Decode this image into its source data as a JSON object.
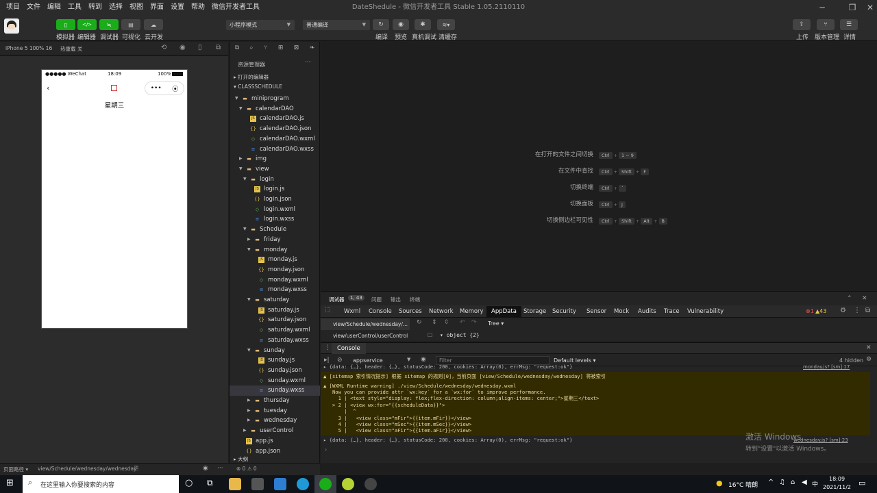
{
  "window": {
    "title": "DateShedule - 微信开发者工具 Stable 1.05.2110110",
    "menu": [
      "项目",
      "文件",
      "编辑",
      "工具",
      "转到",
      "选择",
      "视图",
      "界面",
      "设置",
      "帮助",
      "微信开发者工具"
    ]
  },
  "toolbar": {
    "simulator_label": "模拟器",
    "editor_label": "编辑器",
    "debugger_label": "调试器",
    "visual_label": "可视化",
    "cloud_label": "云开发",
    "mode_select": "小程序模式",
    "compile_select": "普通编译",
    "compile_label": "编译",
    "preview_label": "预览",
    "device_debug_label": "真机调试",
    "clear_cache_label": "清缓存",
    "upload_label": "上传",
    "version_label": "版本管理",
    "details_label": "详情"
  },
  "simulator": {
    "device": "iPhone 5 100% 16",
    "hot_reload": "热重载 关",
    "status_carrier": "●●●●● WeChat",
    "status_time": "18:09",
    "status_battery": "100%",
    "page_text": "星期三"
  },
  "explorer": {
    "title": "资源管理器",
    "open_editors": "打开的编辑器",
    "project": "CLASSSCHEDULE",
    "items": [
      {
        "label": "miniprogram",
        "type": "folder"
      },
      {
        "label": "calendarDAO",
        "type": "folder"
      },
      {
        "label": "calendarDAO.js",
        "type": "js"
      },
      {
        "label": "calendarDAO.json",
        "type": "json"
      },
      {
        "label": "calendarDAO.wxml",
        "type": "wxml"
      },
      {
        "label": "calendarDAO.wxss",
        "type": "wxss"
      },
      {
        "label": "img",
        "type": "folder"
      },
      {
        "label": "view",
        "type": "folder"
      },
      {
        "label": "login",
        "type": "folder"
      },
      {
        "label": "login.js",
        "type": "js"
      },
      {
        "label": "login.json",
        "type": "json"
      },
      {
        "label": "login.wxml",
        "type": "wxml"
      },
      {
        "label": "login.wxss",
        "type": "wxss"
      },
      {
        "label": "Schedule",
        "type": "folder"
      },
      {
        "label": "friday",
        "type": "folder"
      },
      {
        "label": "monday",
        "type": "folder"
      },
      {
        "label": "monday.js",
        "type": "js"
      },
      {
        "label": "monday.json",
        "type": "json"
      },
      {
        "label": "monday.wxml",
        "type": "wxml"
      },
      {
        "label": "monday.wxss",
        "type": "wxss"
      },
      {
        "label": "saturday",
        "type": "folder"
      },
      {
        "label": "saturday.js",
        "type": "js"
      },
      {
        "label": "saturday.json",
        "type": "json"
      },
      {
        "label": "saturday.wxml",
        "type": "wxml"
      },
      {
        "label": "saturday.wxss",
        "type": "wxss"
      },
      {
        "label": "sunday",
        "type": "folder"
      },
      {
        "label": "sunday.js",
        "type": "js"
      },
      {
        "label": "sunday.json",
        "type": "json"
      },
      {
        "label": "sunday.wxml",
        "type": "wxml"
      },
      {
        "label": "sunday.wxss",
        "type": "wxss"
      },
      {
        "label": "thursday",
        "type": "folder"
      },
      {
        "label": "tuesday",
        "type": "folder"
      },
      {
        "label": "wednesday",
        "type": "folder"
      },
      {
        "label": "userControl",
        "type": "folder"
      },
      {
        "label": "app.js",
        "type": "js"
      },
      {
        "label": "app.json",
        "type": "json"
      }
    ],
    "outline": "大纲"
  },
  "editor_hints": [
    {
      "label": "在打开的文件之间切换",
      "keys": [
        "Ctrl",
        "1 ~ 9"
      ]
    },
    {
      "label": "在文件中查找",
      "keys": [
        "Ctrl",
        "Shift",
        "F"
      ]
    },
    {
      "label": "切换终端",
      "keys": [
        "Ctrl",
        "`"
      ]
    },
    {
      "label": "切换面板",
      "keys": [
        "Ctrl",
        "J"
      ]
    },
    {
      "label": "切换侧边栏可见性",
      "keys": [
        "Ctrl",
        "Shift",
        "Alt",
        "B"
      ]
    }
  ],
  "devtools": {
    "panel_tabs": [
      "调试器",
      "问题",
      "输出",
      "终端"
    ],
    "debugger_badge": "1, 43",
    "tabs": [
      "Wxml",
      "Console",
      "Sources",
      "Network",
      "Memory",
      "AppData",
      "Storage",
      "Security",
      "Sensor",
      "Mock",
      "Audits",
      "Trace",
      "Vulnerability"
    ],
    "error_count": "1",
    "warn_count": "43",
    "appdata_pages": [
      "view/Schedule/wednesday/...",
      "view/userControl/userControl"
    ],
    "tree_mode": "Tree",
    "object_summary": "object {2}",
    "console_title": "Console",
    "context": "appservice",
    "filter_placeholder": "Filter",
    "levels": "Default levels",
    "hidden": "4 hidden",
    "lines": [
      "▸ {data: {…}, header: {…}, statusCode: 200, cookies: Array(0), errMsg: \"request:ok\"}",
      "▲ [sitemap 索引情况提示] 根据 sitemap 的规则[0]，当前页面 [view/Schedule/wednesday/wednesday] 将被索引",
      "▲ [WXML Runtime warning] ./view/Schedule/wednesday/wednesday.wxml",
      "   Now you can provide attr `wx:key` for a `wx:for` to improve performance.",
      "     1 | <text style=\"display: flex;flex-direction: column;align-items: center;\">星期三</text>",
      "   > 2 | <view wx:for=\"{{scheduleData}}\">",
      "       |  ^",
      "     3 |   <view class=\"mFir\">{{item.mFir}}</view>",
      "     4 |   <view class=\"mSec\">{{item.mSec}}</view>",
      "     5 |   <view class=\"aFir\">{{item.aFir}}</view>",
      "▸ {data: {…}, header: {…}, statusCode: 200, cookies: Array(0), errMsg: \"request:ok\"}"
    ],
    "source_links": [
      "monday.js? [sm]:17",
      "wednesday.js? [sm]:23"
    ],
    "watermark_1": "激活 Windows",
    "watermark_2": "转到\"设置\"以激活 Windows。"
  },
  "statusbar": {
    "page_path_label": "页面路径",
    "page_path": "view/Schedule/wednesday/wednesday",
    "problems": "⊗ 0 ⚠ 0"
  },
  "taskbar": {
    "search_placeholder": "在这里输入你要搜索的内容",
    "weather": "16°C 晴朗",
    "ime": "中",
    "time": "18:09",
    "date": "2021/11/2"
  },
  "colors": {
    "accent_green": "#1aad19",
    "warning_bg": "#332b00",
    "folder": "#dcb67a",
    "js": "#e8c54a",
    "wxml": "#6ac259",
    "wxss": "#4a90e2"
  }
}
